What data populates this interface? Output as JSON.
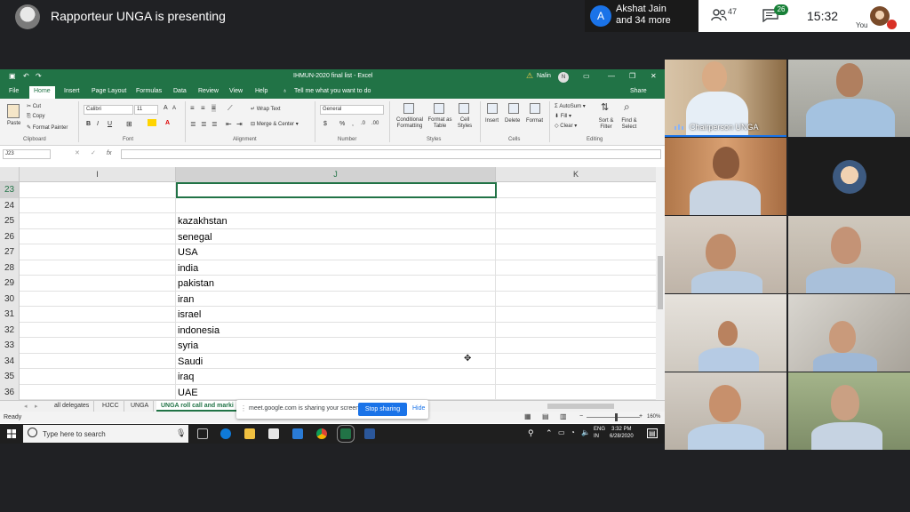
{
  "meet": {
    "presenting_text": "Rapporteur UNGA is presenting",
    "participant": {
      "initial": "A",
      "name_line1": "Akshat Jain",
      "name_line2": "and 34 more"
    },
    "people_count": "47",
    "chat_badge": "26",
    "clock": "15:32",
    "you_label": "You",
    "colors": {
      "accent": "#1a73e8",
      "badge": "#188038",
      "mic_off": "#d93025"
    }
  },
  "excel": {
    "window_title": "IHMUN-2020 final list - Excel",
    "user": "Nalin",
    "user_initial": "N",
    "tabs": [
      "File",
      "Home",
      "Insert",
      "Page Layout",
      "Formulas",
      "Data",
      "Review",
      "View",
      "Help",
      "Tell me what you want to do"
    ],
    "share_label": "Share",
    "ribbon": {
      "clipboard": {
        "paste": "Paste",
        "cut": "Cut",
        "copy": "Copy",
        "format_painter": "Format Painter",
        "group": "Clipboard"
      },
      "font": {
        "name": "Calibri",
        "size": "11",
        "group": "Font",
        "bold": "B",
        "italic": "I",
        "underline": "U"
      },
      "alignment": {
        "wrap": "Wrap Text",
        "merge": "Merge & Center",
        "group": "Alignment"
      },
      "number": {
        "format": "General",
        "currency": "$",
        "percent": "%",
        "group": "Number"
      },
      "styles": {
        "conditional": "Conditional Formatting",
        "format_table": "Format as Table",
        "cell_styles": "Cell Styles",
        "group": "Styles"
      },
      "cells": {
        "insert": "Insert",
        "delete": "Delete",
        "format": "Format",
        "group": "Cells"
      },
      "editing": {
        "autosum": "AutoSum",
        "fill": "Fill",
        "clear": "Clear",
        "sort": "Sort & Filter",
        "find": "Find & Select",
        "group": "Editing"
      }
    },
    "name_box": "J23",
    "fx": "fx",
    "columns": [
      "I",
      "J",
      "K"
    ],
    "rows": [
      {
        "num": "23",
        "value": ""
      },
      {
        "num": "24",
        "value": ""
      },
      {
        "num": "25",
        "value": "kazakhstan"
      },
      {
        "num": "26",
        "value": "senegal"
      },
      {
        "num": "27",
        "value": "USA"
      },
      {
        "num": "28",
        "value": "india"
      },
      {
        "num": "29",
        "value": "pakistan"
      },
      {
        "num": "30",
        "value": "iran"
      },
      {
        "num": "31",
        "value": "israel"
      },
      {
        "num": "32",
        "value": "indonesia"
      },
      {
        "num": "33",
        "value": "syria"
      },
      {
        "num": "34",
        "value": "Saudi"
      },
      {
        "num": "35",
        "value": "iraq"
      },
      {
        "num": "36",
        "value": "UAE"
      }
    ],
    "sheet_tabs": [
      "all delegates",
      "HJCC",
      "UNGA",
      "UNGA roll call and marki"
    ],
    "status": "Ready",
    "zoom": "160%",
    "colors": {
      "brand": "#217346"
    }
  },
  "share_notice": {
    "text": "meet.google.com is sharing your screen.",
    "stop": "Stop sharing",
    "hide": "Hide"
  },
  "taskbar": {
    "search_placeholder": "Type here to search",
    "lang1": "ENG",
    "lang2": "IN",
    "time": "3:32 PM",
    "date": "6/28/2020"
  },
  "tiles": [
    {
      "label": "Chairperson UNGA"
    }
  ]
}
